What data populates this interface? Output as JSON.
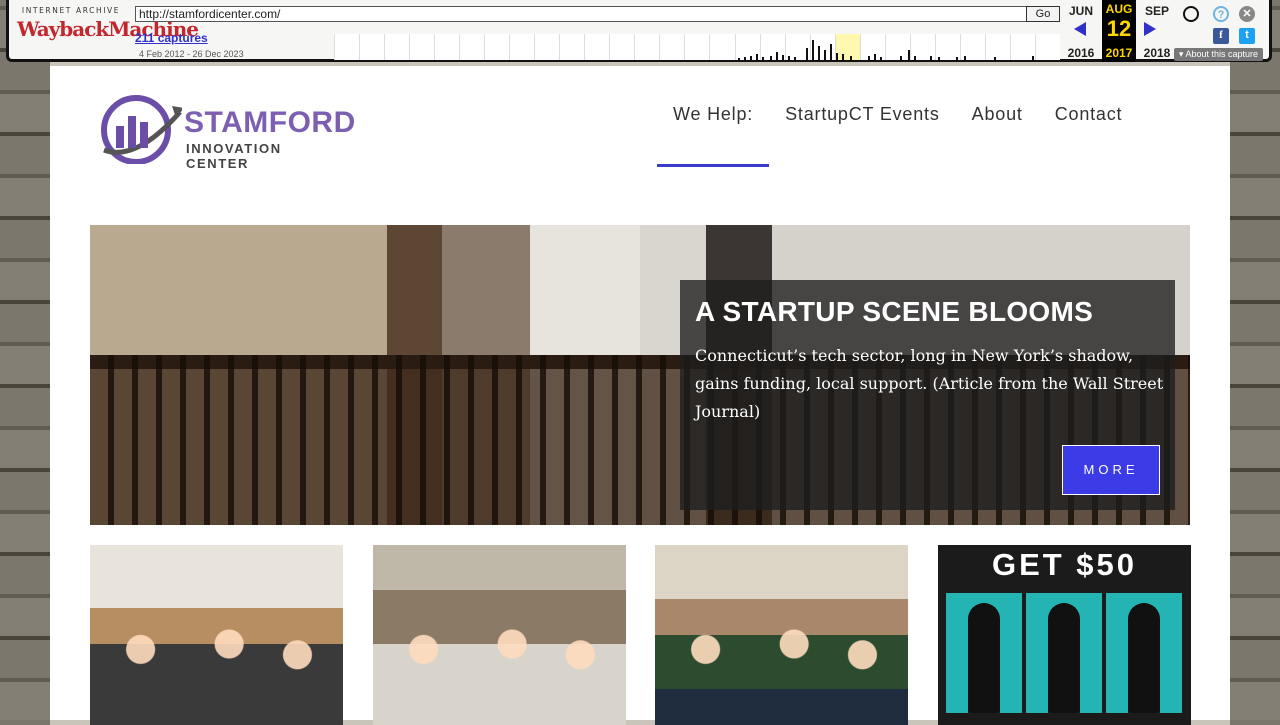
{
  "wayback": {
    "logo_top": "INTERNET ARCHIVE",
    "logo_main": "WaybackMachine",
    "url": "http://stamfordicenter.com/",
    "go_label": "Go",
    "captures": "211 captures",
    "range": "4 Feb 2012 - 26 Dec 2023",
    "months": {
      "prev": "JUN",
      "current": "AUG",
      "next": "SEP"
    },
    "day": "12",
    "years": {
      "prev": "2016",
      "current": "2017",
      "next": "2018"
    },
    "about": "About this capture",
    "icons": [
      "user-icon",
      "help-icon",
      "close-icon",
      "facebook-icon",
      "twitter-icon"
    ]
  },
  "site": {
    "logo_line1": "STAMFORD",
    "logo_line2": "INNOVATION CENTER",
    "nav": [
      "We Help:",
      "StartupCT Events",
      "About",
      "Contact"
    ],
    "active_nav": "We Help:",
    "accent_color": "#3b3be8"
  },
  "hero": {
    "title": "A STARTUP SCENE BLOOMS",
    "text": "Connecticut’s tech sector, long in New York’s shadow, gains funding, local support. (Article from the Wall Street Journal)",
    "button": "MORE"
  },
  "promo": {
    "headline": "GET $50"
  }
}
